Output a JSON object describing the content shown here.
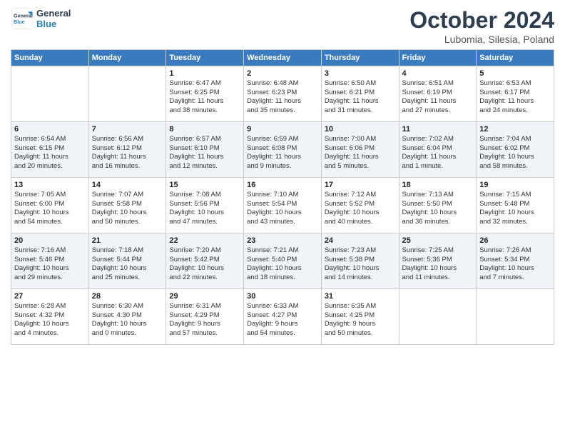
{
  "header": {
    "logo_general": "General",
    "logo_blue": "Blue",
    "month_title": "October 2024",
    "subtitle": "Lubomia, Silesia, Poland"
  },
  "days_of_week": [
    "Sunday",
    "Monday",
    "Tuesday",
    "Wednesday",
    "Thursday",
    "Friday",
    "Saturday"
  ],
  "weeks": [
    [
      {
        "day": "",
        "info": ""
      },
      {
        "day": "",
        "info": ""
      },
      {
        "day": "1",
        "info": "Sunrise: 6:47 AM\nSunset: 6:25 PM\nDaylight: 11 hours\nand 38 minutes."
      },
      {
        "day": "2",
        "info": "Sunrise: 6:48 AM\nSunset: 6:23 PM\nDaylight: 11 hours\nand 35 minutes."
      },
      {
        "day": "3",
        "info": "Sunrise: 6:50 AM\nSunset: 6:21 PM\nDaylight: 11 hours\nand 31 minutes."
      },
      {
        "day": "4",
        "info": "Sunrise: 6:51 AM\nSunset: 6:19 PM\nDaylight: 11 hours\nand 27 minutes."
      },
      {
        "day": "5",
        "info": "Sunrise: 6:53 AM\nSunset: 6:17 PM\nDaylight: 11 hours\nand 24 minutes."
      }
    ],
    [
      {
        "day": "6",
        "info": "Sunrise: 6:54 AM\nSunset: 6:15 PM\nDaylight: 11 hours\nand 20 minutes."
      },
      {
        "day": "7",
        "info": "Sunrise: 6:56 AM\nSunset: 6:12 PM\nDaylight: 11 hours\nand 16 minutes."
      },
      {
        "day": "8",
        "info": "Sunrise: 6:57 AM\nSunset: 6:10 PM\nDaylight: 11 hours\nand 12 minutes."
      },
      {
        "day": "9",
        "info": "Sunrise: 6:59 AM\nSunset: 6:08 PM\nDaylight: 11 hours\nand 9 minutes."
      },
      {
        "day": "10",
        "info": "Sunrise: 7:00 AM\nSunset: 6:06 PM\nDaylight: 11 hours\nand 5 minutes."
      },
      {
        "day": "11",
        "info": "Sunrise: 7:02 AM\nSunset: 6:04 PM\nDaylight: 11 hours\nand 1 minute."
      },
      {
        "day": "12",
        "info": "Sunrise: 7:04 AM\nSunset: 6:02 PM\nDaylight: 10 hours\nand 58 minutes."
      }
    ],
    [
      {
        "day": "13",
        "info": "Sunrise: 7:05 AM\nSunset: 6:00 PM\nDaylight: 10 hours\nand 54 minutes."
      },
      {
        "day": "14",
        "info": "Sunrise: 7:07 AM\nSunset: 5:58 PM\nDaylight: 10 hours\nand 50 minutes."
      },
      {
        "day": "15",
        "info": "Sunrise: 7:08 AM\nSunset: 5:56 PM\nDaylight: 10 hours\nand 47 minutes."
      },
      {
        "day": "16",
        "info": "Sunrise: 7:10 AM\nSunset: 5:54 PM\nDaylight: 10 hours\nand 43 minutes."
      },
      {
        "day": "17",
        "info": "Sunrise: 7:12 AM\nSunset: 5:52 PM\nDaylight: 10 hours\nand 40 minutes."
      },
      {
        "day": "18",
        "info": "Sunrise: 7:13 AM\nSunset: 5:50 PM\nDaylight: 10 hours\nand 36 minutes."
      },
      {
        "day": "19",
        "info": "Sunrise: 7:15 AM\nSunset: 5:48 PM\nDaylight: 10 hours\nand 32 minutes."
      }
    ],
    [
      {
        "day": "20",
        "info": "Sunrise: 7:16 AM\nSunset: 5:46 PM\nDaylight: 10 hours\nand 29 minutes."
      },
      {
        "day": "21",
        "info": "Sunrise: 7:18 AM\nSunset: 5:44 PM\nDaylight: 10 hours\nand 25 minutes."
      },
      {
        "day": "22",
        "info": "Sunrise: 7:20 AM\nSunset: 5:42 PM\nDaylight: 10 hours\nand 22 minutes."
      },
      {
        "day": "23",
        "info": "Sunrise: 7:21 AM\nSunset: 5:40 PM\nDaylight: 10 hours\nand 18 minutes."
      },
      {
        "day": "24",
        "info": "Sunrise: 7:23 AM\nSunset: 5:38 PM\nDaylight: 10 hours\nand 14 minutes."
      },
      {
        "day": "25",
        "info": "Sunrise: 7:25 AM\nSunset: 5:36 PM\nDaylight: 10 hours\nand 11 minutes."
      },
      {
        "day": "26",
        "info": "Sunrise: 7:26 AM\nSunset: 5:34 PM\nDaylight: 10 hours\nand 7 minutes."
      }
    ],
    [
      {
        "day": "27",
        "info": "Sunrise: 6:28 AM\nSunset: 4:32 PM\nDaylight: 10 hours\nand 4 minutes."
      },
      {
        "day": "28",
        "info": "Sunrise: 6:30 AM\nSunset: 4:30 PM\nDaylight: 10 hours\nand 0 minutes."
      },
      {
        "day": "29",
        "info": "Sunrise: 6:31 AM\nSunset: 4:29 PM\nDaylight: 9 hours\nand 57 minutes."
      },
      {
        "day": "30",
        "info": "Sunrise: 6:33 AM\nSunset: 4:27 PM\nDaylight: 9 hours\nand 54 minutes."
      },
      {
        "day": "31",
        "info": "Sunrise: 6:35 AM\nSunset: 4:25 PM\nDaylight: 9 hours\nand 50 minutes."
      },
      {
        "day": "",
        "info": ""
      },
      {
        "day": "",
        "info": ""
      }
    ]
  ]
}
